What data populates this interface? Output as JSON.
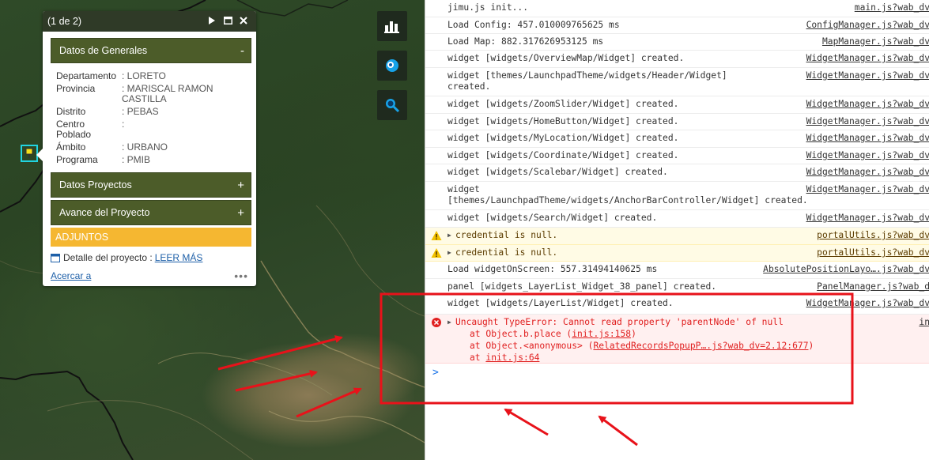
{
  "popup": {
    "counter": "(1 de 2)",
    "section_general": "Datos de Generales",
    "section_general_sign": "-",
    "fields": [
      {
        "key": "Departamento",
        "value": ": LORETO"
      },
      {
        "key": "Provincia",
        "value": ": MARISCAL RAMON\nCASTILLA"
      },
      {
        "key": "Distrito",
        "value": ": PEBAS"
      },
      {
        "key": "Centro\nPoblado",
        "value": ":"
      },
      {
        "key": "Ámbito",
        "value": ": URBANO"
      },
      {
        "key": "Programa",
        "value": ": PMIB"
      }
    ],
    "section_proyectos": "Datos Proyectos",
    "section_avance": "Avance del Proyecto",
    "expand_sign": "+",
    "adjuntos": "ADJUNTOS",
    "detalle_label": "Detalle del proyecto :",
    "detalle_link": "LEER MÁS",
    "zoom_link": "Acercar a",
    "more": "•••"
  },
  "console": {
    "rows": [
      {
        "msg": "jimu.js init...",
        "src": "main.js?wab_dv"
      },
      {
        "msg": "Load Config: 457.010009765625 ms",
        "src": "ConfigManager.js?wab_dv"
      },
      {
        "msg": "Load Map: 882.317626953125 ms",
        "src": "MapManager.js?wab_dv"
      },
      {
        "msg": "widget [widgets/OverviewMap/Widget] created.",
        "src": "WidgetManager.js?wab_dv"
      },
      {
        "msg": "widget [themes/LaunchpadTheme/widgets/Header/Widget]\ncreated.",
        "src": "WidgetManager.js?wab_dv"
      },
      {
        "msg": "widget [widgets/ZoomSlider/Widget] created.",
        "src": "WidgetManager.js?wab_dv"
      },
      {
        "msg": "widget [widgets/HomeButton/Widget] created.",
        "src": "WidgetManager.js?wab_dv"
      },
      {
        "msg": "widget [widgets/MyLocation/Widget] created.",
        "src": "WidgetManager.js?wab_dv"
      },
      {
        "msg": "widget [widgets/Coordinate/Widget] created.",
        "src": "WidgetManager.js?wab_dv"
      },
      {
        "msg": "widget [widgets/Scalebar/Widget] created.",
        "src": "WidgetManager.js?wab_dv"
      },
      {
        "msg": "widget\n[themes/LaunchpadTheme/widgets/AnchorBarController/Widget] created.",
        "src": "WidgetManager.js?wab_dv"
      },
      {
        "msg": "widget [widgets/Search/Widget] created.",
        "src": "WidgetManager.js?wab_dv"
      },
      {
        "msg": "credential is null.",
        "src": "portalUtils.js?wab_dv"
      },
      {
        "msg": "credential is null.",
        "src": "portalUtils.js?wab_dv"
      },
      {
        "msg": "Load widgetOnScreen: 557.31494140625 ms",
        "src": "AbsolutePositionLayo….js?wab_dv"
      },
      {
        "msg": "panel [widgets_LayerList_Widget_38_panel] created.",
        "src": "PanelManager.js?wab_d"
      },
      {
        "msg": "widget [widgets/LayerList/Widget] created.",
        "src": "WidgetManager.js?wab_dv"
      }
    ],
    "error": {
      "msg": "Uncaught TypeError: Cannot read property 'parentNode' of null",
      "src": "in",
      "line1_prefix": "at Object.b.place (",
      "line1_link": "init.js:158",
      "line1_suffix": ")",
      "line2_prefix": "at Object.<anonymous> (",
      "line2_link": "RelatedRecordsPopupP….js?wab_dv=2.12:677",
      "line2_suffix": ")",
      "line3_prefix": "at ",
      "line3_link": "init.js:64"
    },
    "prompt": ">"
  },
  "colors": {
    "section_bar": "#4c5c29",
    "adjuntos": "#f5b731",
    "popup_header": "#2f3a27",
    "error_text": "#e02020",
    "warning_bg": "#fffbe5",
    "annotation": "#e8121a"
  },
  "icons": {
    "map_buttons": [
      "chart-icon",
      "layers-icon",
      "search-map-icon"
    ],
    "popup_header": [
      "play-icon",
      "maximize-icon",
      "close-icon"
    ]
  }
}
